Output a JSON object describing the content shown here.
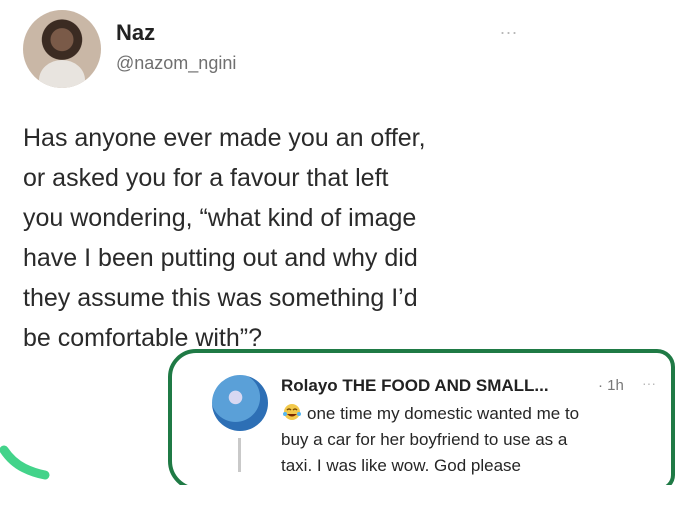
{
  "tweet": {
    "author_name": "Naz",
    "author_handle": "@nazom_ngini",
    "more_label": "...",
    "text_lines": [
      "Has anyone ever made you an offer,",
      "or asked you for a favour that left",
      "you wondering, “what kind of image",
      "have I been putting out and why did",
      "they assume this was something I’d",
      "be comfortable with”?"
    ]
  },
  "reply": {
    "author_name": "Rolayo THE FOOD AND SMALL...",
    "time": "· 1h",
    "more_label": "···",
    "text_lines": [
      "one time my domestic wanted me to",
      "buy a car for her boyfriend to use as a",
      "taxi. I was like wow. God please"
    ]
  },
  "colors": {
    "highlight_border": "#1f7a45",
    "scribble": "#43d38a"
  },
  "icons": {
    "more": "more-dots-icon",
    "emoji": "laughing-face-icon"
  }
}
